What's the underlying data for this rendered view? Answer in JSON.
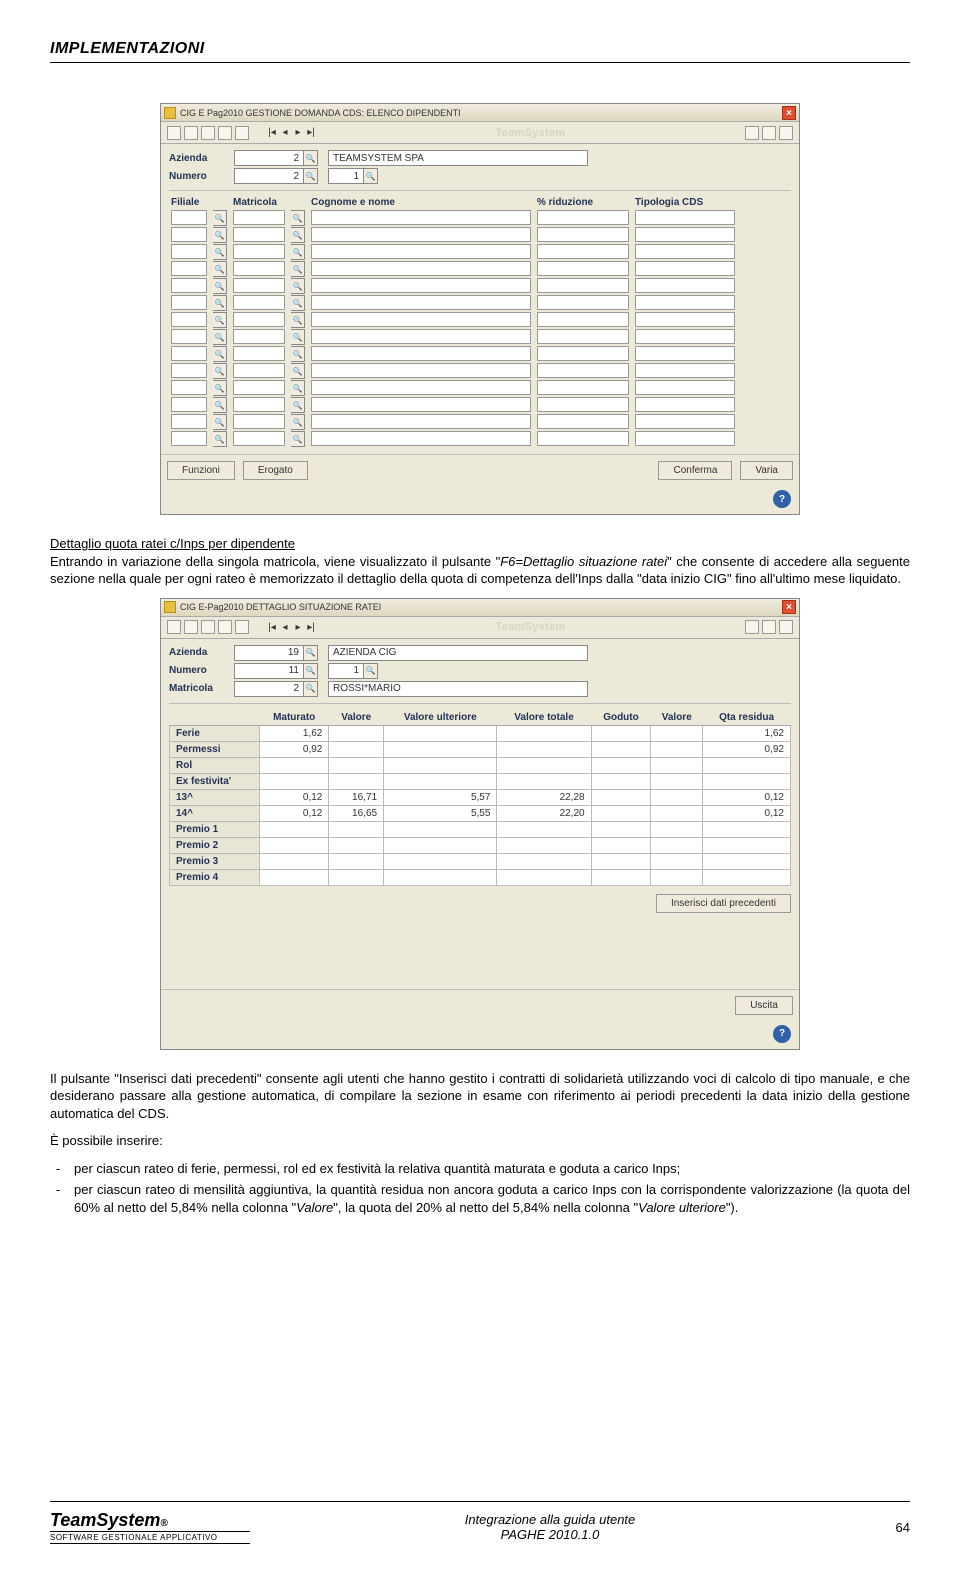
{
  "header": {
    "title": "IMPLEMENTAZIONI"
  },
  "window1": {
    "title": "CIG   E Pag2010    GESTIONE DOMANDA CDS: ELENCO DIPENDENTI",
    "watermark": "TeamSystem",
    "fields": {
      "azienda_lbl": "Azienda",
      "azienda_val": "2",
      "azienda_name": "TEAMSYSTEM SPA",
      "numero_lbl": "Numero",
      "numero_val1": "2",
      "numero_val2": "1"
    },
    "grid_headers": {
      "filiale": "Filiale",
      "matricola": "Matricola",
      "cognome": "Cognome e nome",
      "riduzione": "% riduzione",
      "tipologia": "Tipologia CDS"
    },
    "buttons": {
      "funzioni": "Funzioni",
      "erogato": "Erogato",
      "conferma": "Conferma",
      "varia": "Varia"
    }
  },
  "para1": {
    "title": "Dettaglio quota ratei c/Inps per dipendente",
    "text_a": "Entrando in variazione della singola matricola, viene visualizzato il pulsante \"",
    "text_b": "F6=Dettaglio situazione ratei",
    "text_c": "\" che consente di accedere alla seguente sezione nella quale per ogni rateo è memorizzato il dettaglio della quota di competenza dell'Inps dalla \"data inizio CIG\" fino all'ultimo mese liquidato."
  },
  "window2": {
    "title": "CIG   E-Pag2010    DETTAGLIO SITUAZIONE RATEI",
    "watermark": "TeamSystem",
    "fields": {
      "azienda_lbl": "Azienda",
      "azienda_val": "19",
      "azienda_name": "AZIENDA CIG",
      "numero_lbl": "Numero",
      "numero_val1": "11",
      "numero_val2": "1",
      "matricola_lbl": "Matricola",
      "matricola_val": "2",
      "matricola_name": "ROSSI*MARIO"
    },
    "headers": {
      "maturato": "Maturato",
      "valore": "Valore",
      "valore_ult": "Valore ulteriore",
      "valore_tot": "Valore totale",
      "goduto": "Goduto",
      "valore2": "Valore",
      "residua": "Qta residua"
    },
    "rows": [
      {
        "label": "Ferie",
        "maturato": "1,62",
        "valore": "",
        "ult": "",
        "tot": "",
        "goduto": "",
        "val2": "",
        "res": "1,62"
      },
      {
        "label": "Permessi",
        "maturato": "0,92",
        "valore": "",
        "ult": "",
        "tot": "",
        "goduto": "",
        "val2": "",
        "res": "0,92"
      },
      {
        "label": "Rol",
        "maturato": "",
        "valore": "",
        "ult": "",
        "tot": "",
        "goduto": "",
        "val2": "",
        "res": ""
      },
      {
        "label": "Ex festivita'",
        "maturato": "",
        "valore": "",
        "ult": "",
        "tot": "",
        "goduto": "",
        "val2": "",
        "res": ""
      },
      {
        "label": "13^",
        "maturato": "0,12",
        "valore": "16,71",
        "ult": "5,57",
        "tot": "22,28",
        "goduto": "",
        "val2": "",
        "res": "0,12"
      },
      {
        "label": "14^",
        "maturato": "0,12",
        "valore": "16,65",
        "ult": "5,55",
        "tot": "22,20",
        "goduto": "",
        "val2": "",
        "res": "0,12"
      },
      {
        "label": "Premio 1",
        "maturato": "",
        "valore": "",
        "ult": "",
        "tot": "",
        "goduto": "",
        "val2": "",
        "res": ""
      },
      {
        "label": "Premio 2",
        "maturato": "",
        "valore": "",
        "ult": "",
        "tot": "",
        "goduto": "",
        "val2": "",
        "res": ""
      },
      {
        "label": "Premio 3",
        "maturato": "",
        "valore": "",
        "ult": "",
        "tot": "",
        "goduto": "",
        "val2": "",
        "res": ""
      },
      {
        "label": "Premio 4",
        "maturato": "",
        "valore": "",
        "ult": "",
        "tot": "",
        "goduto": "",
        "val2": "",
        "res": ""
      }
    ],
    "buttons": {
      "inserisci": "Inserisci dati precedenti",
      "uscita": "Uscita"
    }
  },
  "para2": "Il pulsante \"Inserisci dati precedenti\" consente agli utenti che hanno gestito i contratti di solidarietà utilizzando voci di calcolo di tipo manuale, e che desiderano passare alla gestione automatica, di compilare la sezione in esame con riferimento ai periodi precedenti la data inizio della gestione automatica del CDS.",
  "para3": {
    "intro": "È possibile inserire:",
    "li1": "per ciascun rateo di ferie, permessi, rol ed ex festività la relativa quantità maturata e goduta a carico Inps;",
    "li2_a": "per ciascun rateo di mensilità aggiuntiva, la quantità residua non ancora goduta a carico Inps con la corrispondente valorizzazione (la quota del 60% al netto del 5,84% nella colonna \"",
    "li2_b": "Valore",
    "li2_c": "\", la quota del 20% al netto del 5,84% nella colonna \"",
    "li2_d": "Valore ulteriore",
    "li2_e": "\")."
  },
  "footer": {
    "logo": "TeamSystem",
    "logo_sub": "SOFTWARE GESTIONALE APPLICATIVO",
    "line1": "Integrazione alla guida utente",
    "line2": "PAGHE 2010.1.0",
    "page": "64"
  }
}
